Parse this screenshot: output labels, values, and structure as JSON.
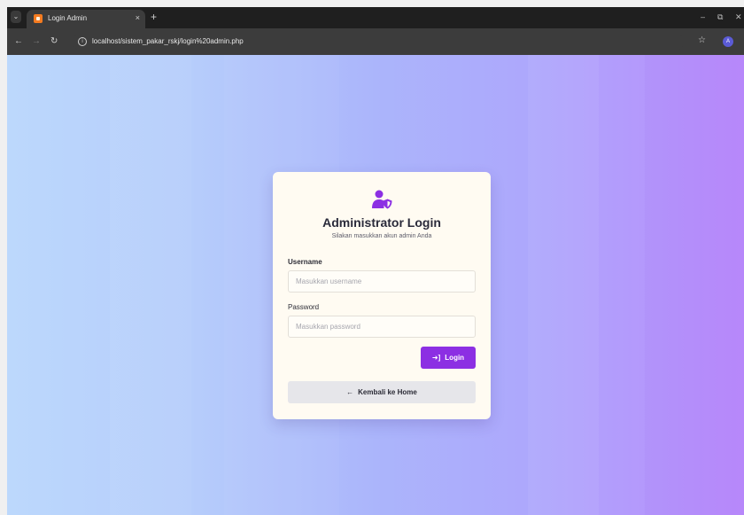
{
  "browser": {
    "tab": {
      "title": "Login Admin",
      "favicon": "xampp-favicon",
      "close_icon": "×"
    },
    "new_tab_icon": "+",
    "menu_icon": "⌄",
    "window_controls": {
      "minimize": "–",
      "restore": "⧉",
      "close": "✕"
    },
    "nav": {
      "back": "←",
      "forward": "→",
      "reload": "↻"
    },
    "info_icon": "i",
    "url": "localhost/sistem_pakar_rskj/login%20admin.php",
    "bookmark_icon": "☆",
    "profile_initial": "A"
  },
  "login": {
    "title": "Administrator Login",
    "subtitle": "Silakan masukkan akun admin Anda",
    "username_label": "Username",
    "username_placeholder": "Masukkan username",
    "username_value": "",
    "password_label": "Password",
    "password_placeholder": "Masukkan password",
    "password_value": "",
    "login_icon": "➜]",
    "login_label": "Login",
    "home_icon": "←",
    "home_label": "Kembali ke Home",
    "icon": "user-shield-icon"
  },
  "colors": {
    "accent": "#8c2fe3",
    "card_bg": "#fffbf2",
    "gradient_start": "#bcd8fc",
    "gradient_end": "#ba8cfb"
  }
}
